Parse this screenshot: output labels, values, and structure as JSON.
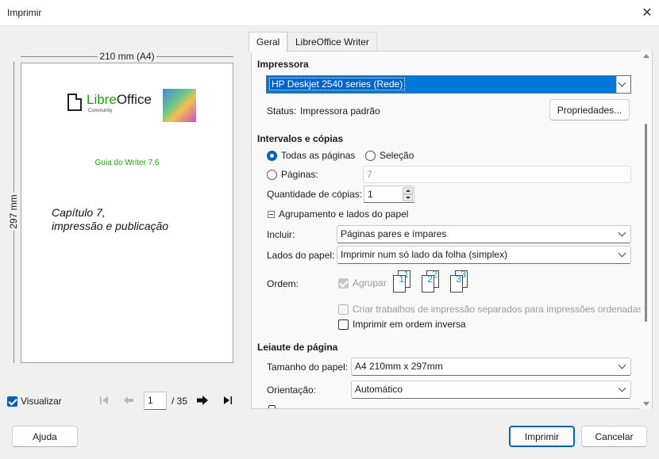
{
  "window": {
    "title": "Imprimir"
  },
  "preview": {
    "width_label": "210 mm (A4)",
    "height_label": "297 mm",
    "page": {
      "logo_prefix": "Libre",
      "logo_suffix": "Office",
      "logo_sub": "Community",
      "book_title": "Guia do Writer 7.6",
      "chapter_line1": "Capítulo 7,",
      "chapter_line2": "impressão e publicação"
    },
    "visualizar_label": "Visualizar",
    "visualizar_checked": true,
    "current_page": "1",
    "total_pages": "/ 35"
  },
  "tabs": [
    {
      "label": "Geral",
      "active": true
    },
    {
      "label": "LibreOffice Writer",
      "active": false
    }
  ],
  "printer": {
    "section": "Impressora",
    "selected": "HP Deskjet 2540 series (Rede)",
    "status_label": "Status:",
    "status_value": "Impressora padrão",
    "properties_button": "Propriedades..."
  },
  "ranges": {
    "section": "Intervalos e cópias",
    "all_pages": "Todas as páginas",
    "selection": "Seleção",
    "pages_label": "Páginas:",
    "pages_value": "7",
    "copies_label": "Quantidade de cópias:",
    "copies_value": "1",
    "grouping_label": "Agrupamento e lados do papel",
    "include_label": "Incluir:",
    "include_value": "Páginas pares e ímpares",
    "sides_label": "Lados do papel:",
    "sides_value": "Imprimir num só lado da folha (simplex)",
    "order_label": "Ordem:",
    "collate_label": "Agrupar",
    "separate_jobs_label": "Criar trabalhos de impressão separados para impressões ordenadas",
    "reverse_label": "Imprimir em ordem inversa"
  },
  "layout": {
    "section": "Leiaute de página",
    "paper_size_label": "Tamanho do papel:",
    "paper_size_value": "A4 210mm x 297mm",
    "orientation_label": "Orientação:",
    "orientation_value": "Automático"
  },
  "buttons": {
    "help": "Ajuda",
    "print": "Imprimir",
    "cancel": "Cancelar"
  },
  "colors": {
    "accent": "#005fb8",
    "selection": "#0078d7",
    "logo_green": "#18a303"
  }
}
